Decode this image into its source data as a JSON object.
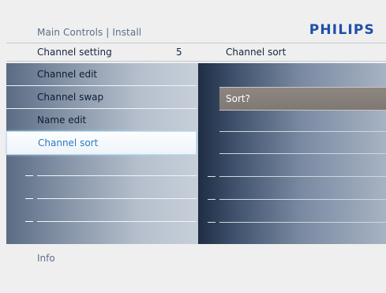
{
  "breadcrumb": "Main Controls | Install",
  "brand": "PHILIPS",
  "header": {
    "left_title": "Channel setting",
    "left_value": "5",
    "right_title": "Channel sort"
  },
  "left_menu": {
    "items": [
      {
        "label": "Channel edit"
      },
      {
        "label": "Channel swap"
      },
      {
        "label": "Name edit"
      },
      {
        "label": "Channel sort"
      }
    ],
    "selected": "Channel sort"
  },
  "right_panel": {
    "prompt": "Sort?"
  },
  "info_label": "Info",
  "colors": {
    "brand": "#1e4fa8",
    "selected_text": "#2b7bc1",
    "prompt_bg": "#857e79"
  }
}
